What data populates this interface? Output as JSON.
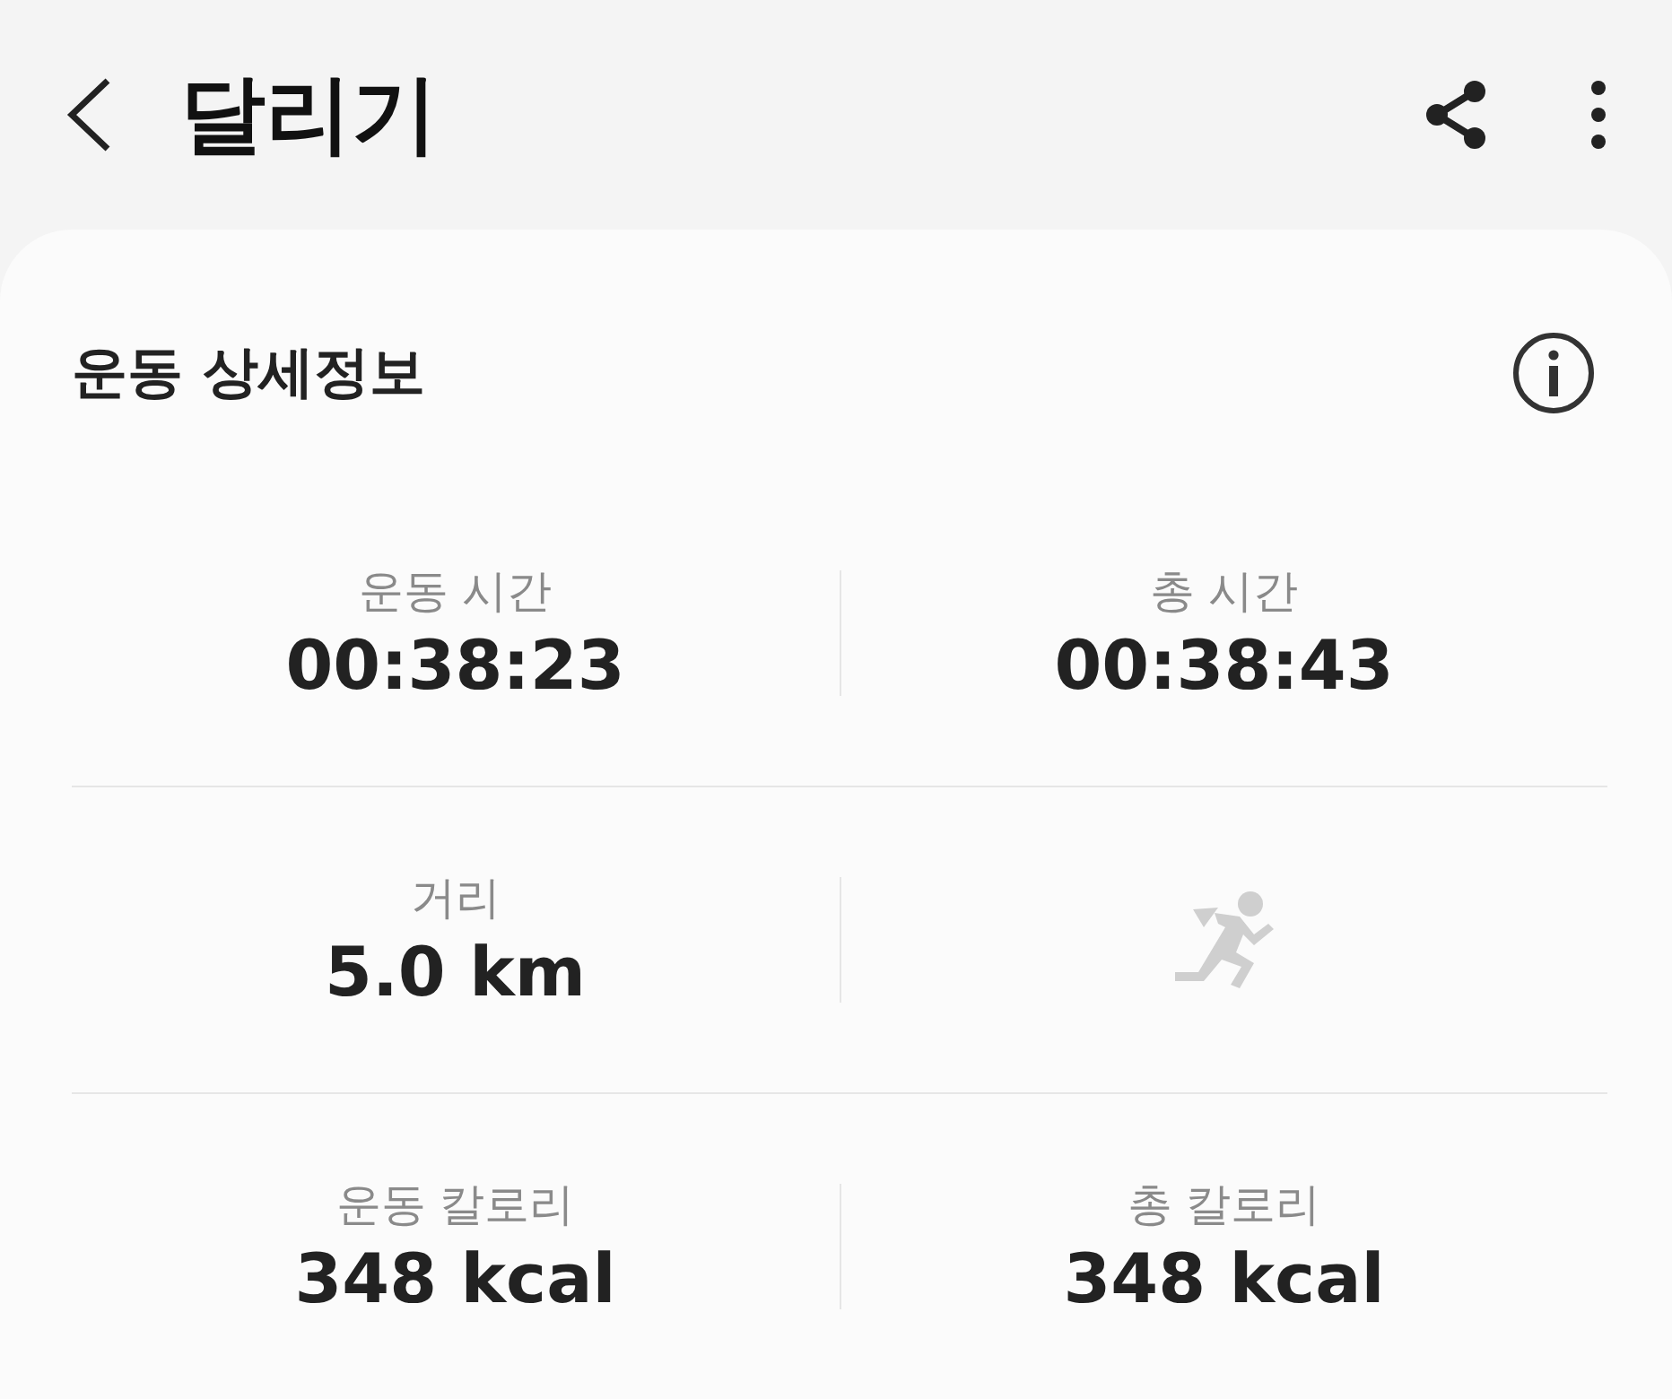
{
  "header": {
    "title": "달리기"
  },
  "card": {
    "title": "운동 상세정보",
    "rows": [
      [
        {
          "kind": "stat",
          "label": "운동 시간",
          "value": "00:38:23"
        },
        {
          "kind": "stat",
          "label": "총 시간",
          "value": "00:38:43"
        }
      ],
      [
        {
          "kind": "stat",
          "label": "거리",
          "value": "5.0 km"
        },
        {
          "kind": "icon"
        }
      ],
      [
        {
          "kind": "stat",
          "label": "운동 칼로리",
          "value": "348 kcal"
        },
        {
          "kind": "stat",
          "label": "총 칼로리",
          "value": "348 kcal"
        }
      ]
    ]
  }
}
